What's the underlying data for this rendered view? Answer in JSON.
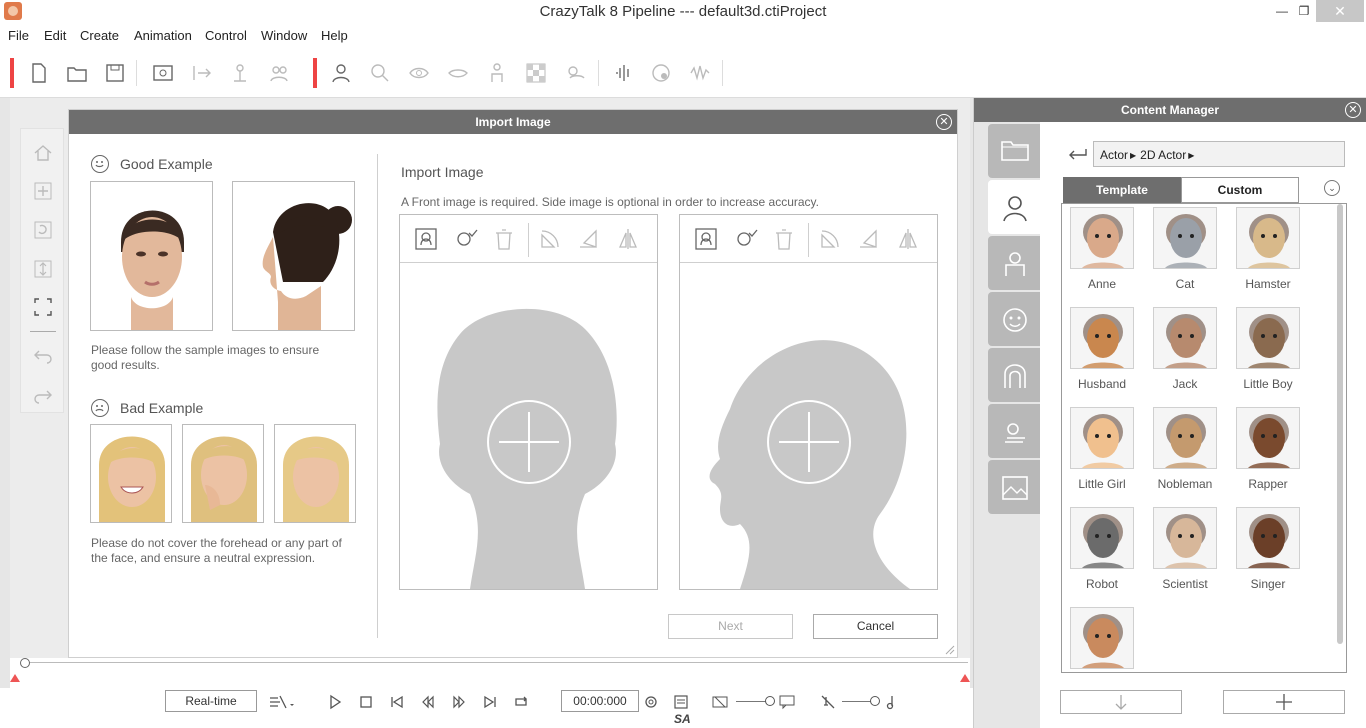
{
  "window": {
    "title": "CrazyTalk 8 Pipeline --- default3d.ctiProject"
  },
  "menu": [
    "File",
    "Edit",
    "Create",
    "Animation",
    "Control",
    "Window",
    "Help"
  ],
  "dialog": {
    "title": "Import Image",
    "good_heading": "Good Example",
    "good_hint_1": "Please follow the sample images to ensure",
    "good_hint_2": "good results.",
    "bad_heading": "Bad Example",
    "bad_hint_1": "Please do not cover the forehead or any part of",
    "bad_hint_2": "the face, and ensure a neutral expression.",
    "import_heading": "Import Image",
    "import_desc": "A Front image is required. Side image is optional in order to increase accuracy.",
    "next_label": "Next",
    "cancel_label": "Cancel"
  },
  "playback": {
    "mode_label": "Real-time",
    "time": "00:00:000"
  },
  "content_manager": {
    "title": "Content Manager",
    "breadcrumb": [
      "Actor",
      "2D Actor"
    ],
    "tab_template": "Template",
    "tab_custom": "Custom",
    "items": [
      {
        "label": "Anne",
        "color": "#d9a98a"
      },
      {
        "label": "Cat",
        "color": "#9aa0a8"
      },
      {
        "label": "Hamster",
        "color": "#d8b98a"
      },
      {
        "label": "Husband",
        "color": "#c9874e"
      },
      {
        "label": "Jack",
        "color": "#b78a6e"
      },
      {
        "label": "Little Boy",
        "color": "#8a6a4f"
      },
      {
        "label": "Little Girl",
        "color": "#f0c08e"
      },
      {
        "label": "Nobleman",
        "color": "#c49a6e"
      },
      {
        "label": "Rapper",
        "color": "#7a4a2e"
      },
      {
        "label": "Robot",
        "color": "#6b6b6b"
      },
      {
        "label": "Scientist",
        "color": "#d7b79a"
      },
      {
        "label": "Singer",
        "color": "#6b3f28"
      },
      {
        "label": "",
        "color": "#c98a5e"
      }
    ]
  },
  "colors": {
    "accent": "#e44444",
    "header": "#6e6e6e",
    "silhouette": "#c8c8c8"
  }
}
